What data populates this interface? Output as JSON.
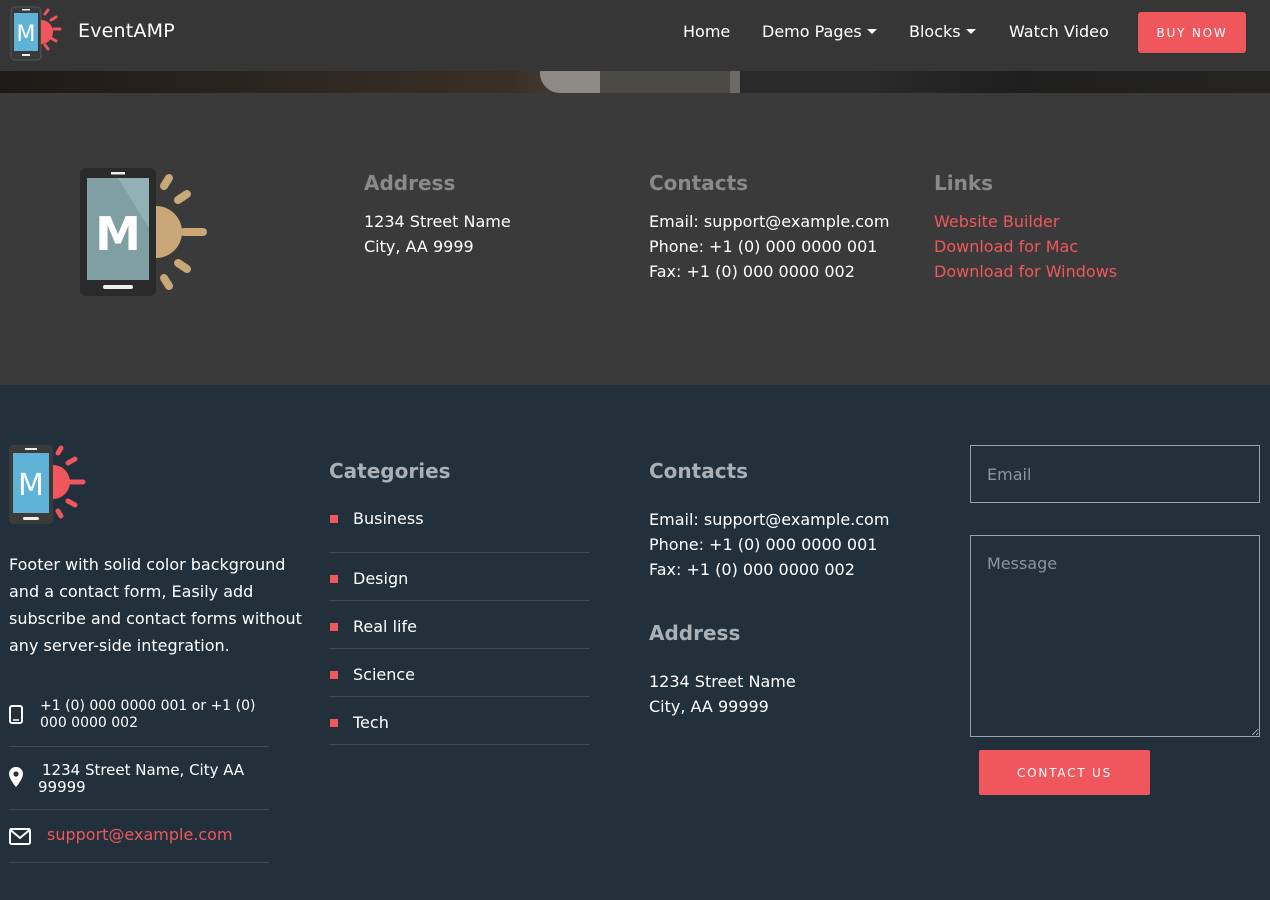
{
  "navbar": {
    "brand": "EventAMP",
    "links": [
      {
        "label": "Home"
      },
      {
        "label": "Demo Pages"
      },
      {
        "label": "Blocks"
      },
      {
        "label": "Watch Video"
      }
    ],
    "buy_button": "BUY NOW",
    "logo_letter": "M"
  },
  "footer_top": {
    "logo_letter": "M",
    "address": {
      "heading": "Address",
      "line1": "1234 Street Name",
      "line2": "City, AA 9999"
    },
    "contacts": {
      "heading": "Contacts",
      "email": "Email: support@example.com",
      "phone": "Phone: +1 (0) 000 0000 001",
      "fax": "Fax: +1 (0) 000 0000 002"
    },
    "links": {
      "heading": "Links",
      "items": [
        "Website Builder",
        "Download for Mac",
        "Download for Windows"
      ]
    }
  },
  "footer_bottom": {
    "logo_letter": "M",
    "description": "Footer with solid color background and a contact form, Easily add subscribe and contact forms without any server-side integration.",
    "phone_line1": "+1 (0) 000 0000 001 or +1 (0)",
    "phone_line2": "000 0000 002",
    "address_line1": "1234 Street Name, City AA",
    "address_line2": "99999",
    "email": "support@example.com",
    "categories": {
      "heading": "Categories",
      "items": [
        "Business",
        "Design",
        "Real life",
        "Science",
        "Tech"
      ]
    },
    "contacts": {
      "heading": "Contacts",
      "email": "Email: support@example.com",
      "phone": "Phone: +1 (0) 000 0000 001",
      "fax": "Fax: +1 (0) 000 0000 002"
    },
    "address": {
      "heading": "Address",
      "line1": "1234 Street Name",
      "line2": "City, AA 99999"
    },
    "form": {
      "email_placeholder": "Email",
      "message_placeholder": "Message",
      "submit": "CONTACT US"
    }
  },
  "colors": {
    "accent": "#f0575d",
    "navbar_bg": "#363636",
    "footer_top_bg": "#3a3a3a",
    "footer_bottom_bg": "#22303c",
    "logo_sun_top": "#c9a877",
    "logo_sun_bottom": "#f0575d"
  },
  "icons": [
    "phone-icon",
    "map-pin-icon",
    "envelope-icon"
  ]
}
